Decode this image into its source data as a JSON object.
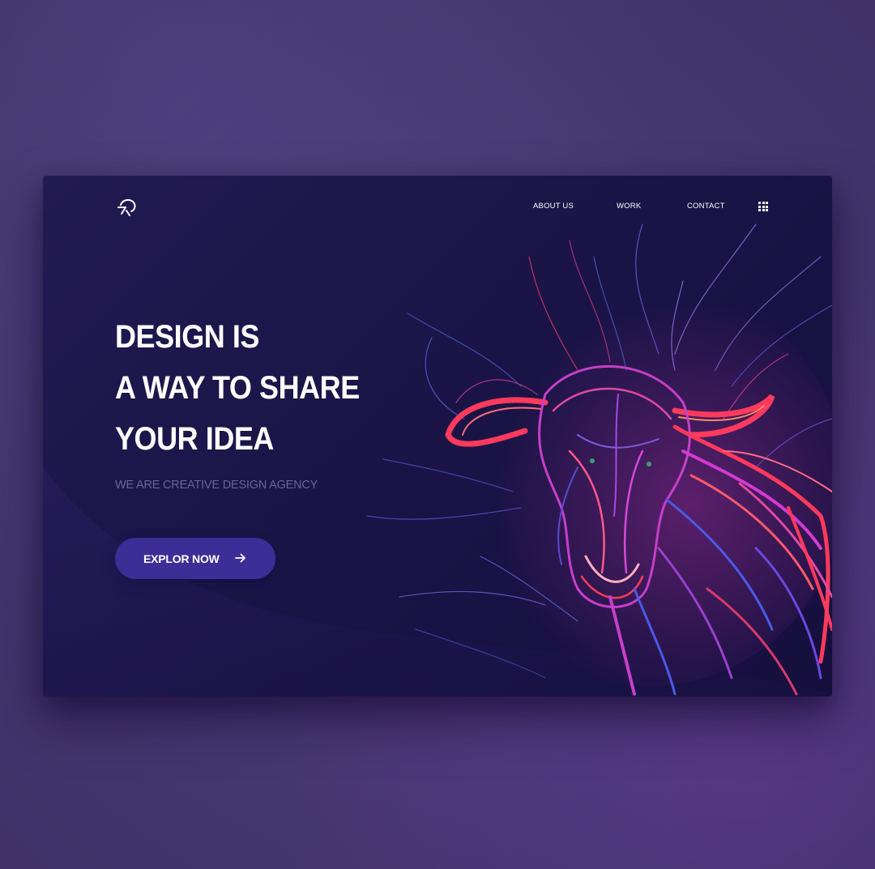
{
  "nav": {
    "about": "ABOUT US",
    "work": "WORK",
    "contact": "CONTACT"
  },
  "hero": {
    "headline": [
      "DESIGN IS",
      "A WAY TO SHARE",
      "YOUR IDEA"
    ],
    "subtitle": "WE ARE CREATIVE DESIGN AGENCY",
    "cta_label": "EXPLOR NOW"
  },
  "icons": {
    "logo": "logo-mark-icon",
    "menu": "grid-menu-icon",
    "cta": "arrow-right-icon"
  },
  "colors": {
    "page_background": "#463974",
    "card_background": "#1b1548",
    "cta_background": "#3d2d96",
    "subtitle_text": "#6a6592",
    "art_red": "#ff3a5c",
    "art_magenta": "#d43ad4",
    "art_blue": "#4a5ae8"
  }
}
